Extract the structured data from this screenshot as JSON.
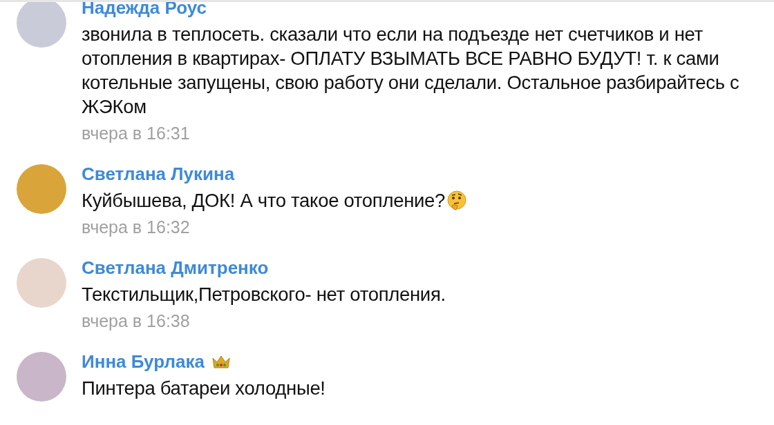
{
  "messages": [
    {
      "author": "Надежда Роус",
      "text": "звонила в теплосеть. сказали что если на подъезде нет счетчиков и нет отопления в квартирах- ОПЛАТУ ВЗЫМАТЬ ВСЕ РАВНО БУДУТ! т. к сами котельные запущены, свою работу они сделали. Остальное разбирайтесь с ЖЭКом",
      "time": "вчера в 16:31"
    },
    {
      "author": "Светлана Лукина",
      "text": "Куйбышева, ДОК! А что такое отопление?",
      "emoji": {
        "kind": "thinking"
      },
      "time": "вчера в 16:32"
    },
    {
      "author": "Светлана Дмитренко",
      "text": "Текстильщик,Петровского- нет отопления.",
      "time": "вчера в 16:38"
    },
    {
      "author": "Инна Бурлака",
      "badge": {
        "kind": "crown"
      },
      "text": "Пинтера батареи холодные!"
    }
  ]
}
